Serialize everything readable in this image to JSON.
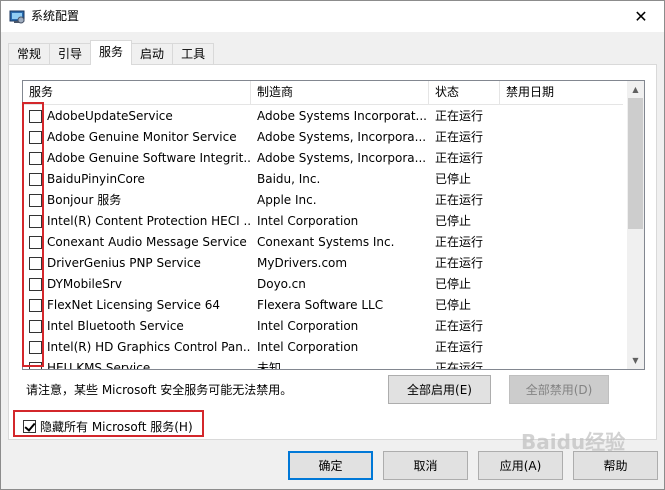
{
  "window": {
    "title": "系统配置",
    "close_glyph": "✕"
  },
  "tabs": [
    {
      "label": "常规",
      "active": false
    },
    {
      "label": "引导",
      "active": false
    },
    {
      "label": "服务",
      "active": true
    },
    {
      "label": "启动",
      "active": false
    },
    {
      "label": "工具",
      "active": false
    }
  ],
  "table": {
    "columns": [
      "服务",
      "制造商",
      "状态",
      "禁用日期"
    ],
    "rows": [
      {
        "service": "AdobeUpdateService",
        "manufacturer": "Adobe Systems Incorporat...",
        "status": "正在运行",
        "disabled_date": ""
      },
      {
        "service": "Adobe Genuine Monitor Service",
        "manufacturer": "Adobe Systems, Incorpora...",
        "status": "正在运行",
        "disabled_date": ""
      },
      {
        "service": "Adobe Genuine Software Integrit...",
        "manufacturer": "Adobe Systems, Incorpora...",
        "status": "正在运行",
        "disabled_date": ""
      },
      {
        "service": "BaiduPinyinCore",
        "manufacturer": "Baidu, Inc.",
        "status": "已停止",
        "disabled_date": ""
      },
      {
        "service": "Bonjour 服务",
        "manufacturer": "Apple Inc.",
        "status": "正在运行",
        "disabled_date": ""
      },
      {
        "service": "Intel(R) Content Protection HECI ...",
        "manufacturer": "Intel Corporation",
        "status": "已停止",
        "disabled_date": ""
      },
      {
        "service": "Conexant Audio Message Service",
        "manufacturer": "Conexant Systems Inc.",
        "status": "正在运行",
        "disabled_date": ""
      },
      {
        "service": "DriverGenius PNP Service",
        "manufacturer": "MyDrivers.com",
        "status": "正在运行",
        "disabled_date": ""
      },
      {
        "service": "DYMobileSrv",
        "manufacturer": "Doyo.cn",
        "status": "已停止",
        "disabled_date": ""
      },
      {
        "service": "FlexNet Licensing Service 64",
        "manufacturer": "Flexera Software LLC",
        "status": "已停止",
        "disabled_date": ""
      },
      {
        "service": "Intel Bluetooth Service",
        "manufacturer": "Intel Corporation",
        "status": "正在运行",
        "disabled_date": ""
      },
      {
        "service": "Intel(R) HD Graphics Control Pan...",
        "manufacturer": "Intel Corporation",
        "status": "正在运行",
        "disabled_date": ""
      },
      {
        "service": "HEU KMS Service",
        "manufacturer": "未知",
        "status": "正在运行",
        "disabled_date": ""
      }
    ]
  },
  "notice": "请注意，某些 Microsoft 安全服务可能无法禁用。",
  "buttons": {
    "enable_all": "全部启用(E)",
    "disable_all": "全部禁用(D)",
    "ok": "确定",
    "cancel": "取消",
    "apply": "应用(A)",
    "help": "帮助"
  },
  "hide_ms": {
    "label": "隐藏所有 Microsoft 服务(H)",
    "checked": true
  },
  "watermark": "Baidu经验",
  "colors": {
    "highlight_red": "#d3272b",
    "default_button_border": "#0078d7"
  }
}
